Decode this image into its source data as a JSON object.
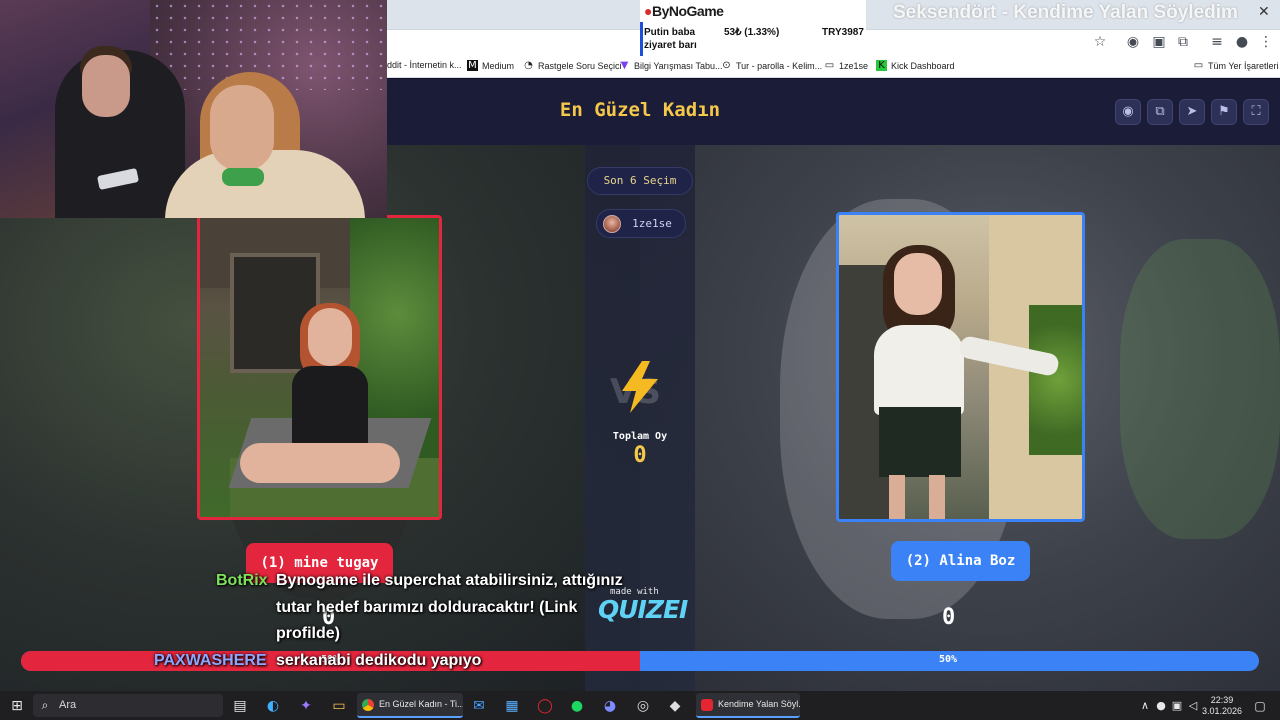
{
  "browser": {
    "bookmarks": [
      {
        "icon": "reddit-icon",
        "label": "ddit - İnternetin k..."
      },
      {
        "icon": "medium-icon",
        "label": "Medium"
      },
      {
        "icon": "question-icon",
        "label": "Rastgele Soru Seçici"
      },
      {
        "icon": "quiz-icon",
        "label": "Bilgi Yarışması Tabu..."
      },
      {
        "icon": "tur-icon",
        "label": "Tur - parolla - Kelim..."
      },
      {
        "icon": "folder-icon",
        "label": "1ze1se"
      },
      {
        "icon": "kick-icon",
        "label": "Kick Dashboard"
      }
    ],
    "all_bookmarks_label": "Tüm Yer İşaretleri"
  },
  "stream_overlay": {
    "bynogame": {
      "logo": "ByNoGame",
      "label": "Putin baba ziyaret barı",
      "amount": "53₺ (1.33%)",
      "target": "TRY3987"
    },
    "now_playing": "Seksendört - Kendime Yalan Söyledim"
  },
  "quiz": {
    "title": "En Güzel Kadın",
    "recent_label": "Son 6 Seçim",
    "user": "1ze1se",
    "total_label": "Toplam Oy",
    "total_value": "0",
    "made_with": "made with",
    "brand": "QUIZEI",
    "left": {
      "label": "(1) mine tugay",
      "count": "0",
      "color": "#e3253d"
    },
    "right": {
      "label": "(2) Alina Boz",
      "count": "0",
      "color": "#3b82f6"
    },
    "progress": {
      "left_percent": 50,
      "left_label": "50%",
      "right_label": "50%"
    },
    "header_icons": [
      "eye-icon",
      "copy-icon",
      "send-icon",
      "flag-icon",
      "fullscreen-icon"
    ]
  },
  "chat": [
    {
      "user": "BotRix",
      "lines": [
        "Bynogame ile superchat atabilirsiniz, attığınız",
        "tutar hedef barımızı dolduracaktır! (Link",
        "profilde)"
      ]
    },
    {
      "user": "PAXWASHERE",
      "lines": [
        "serkanabi dedikodu yapıyo"
      ]
    }
  ],
  "taskbar": {
    "search_placeholder": "Ara",
    "apps": [
      {
        "label": "En Güzel Kadın - Ti...",
        "color": "#f2b233"
      },
      {
        "label": "Kendime Yalan Söyl...",
        "color": "#e3262f"
      }
    ],
    "time": "22:39",
    "date": "3.01.2026"
  }
}
